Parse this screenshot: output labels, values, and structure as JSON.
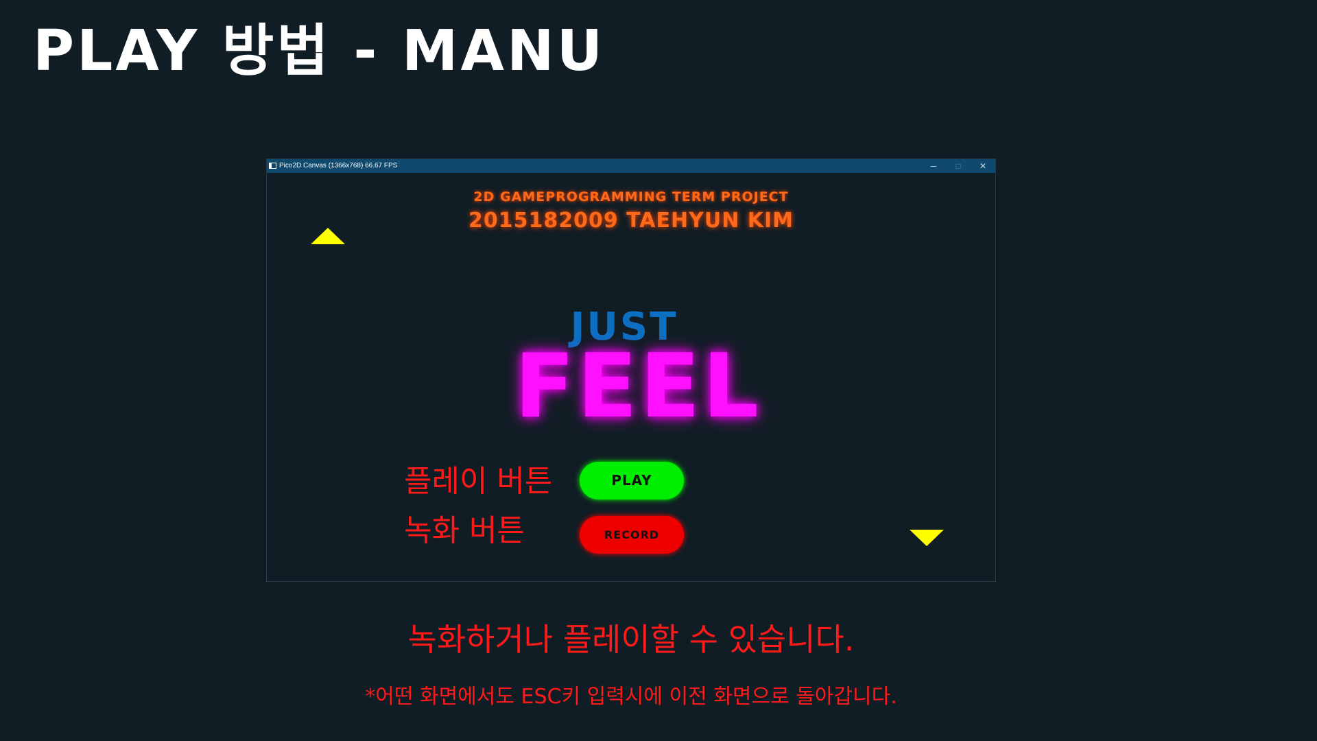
{
  "slide": {
    "title": "PLAY 방법 - MANU",
    "caption": "녹화하거나 플레이할 수 있습니다.",
    "note": "*어떤 화면에서도 ESC키 입력시에 이전 화면으로 돌아갑니다."
  },
  "window": {
    "title": "Pico2D Canvas (1366x768) 66.67 FPS",
    "controls": {
      "minimize": "─",
      "maximize": "□",
      "close": "✕"
    }
  },
  "game": {
    "subtitle_line1": "2D GAMEPROGRAMMING TERM PROJECT",
    "subtitle_line2": "2015182009 TAEHYUN KIM",
    "logo_top": "JUST",
    "logo_main": "FEEL",
    "play_button": "PLAY",
    "record_button": "RECORD",
    "play_annotation": "플레이 버튼",
    "record_annotation": "녹화 버튼",
    "scroll_up_icon": "triangle-up-icon",
    "scroll_down_icon": "triangle-down-icon"
  },
  "colors": {
    "background": "#111d24",
    "titlebar": "#0f4a6e",
    "subtitle": "#ff6a1a",
    "just": "#0d6fc2",
    "feel": "#ff10ff",
    "play_button": "#00ee00",
    "record_button": "#ee0000",
    "annotation": "#ff1a1a",
    "arrows": "#ffff00"
  }
}
